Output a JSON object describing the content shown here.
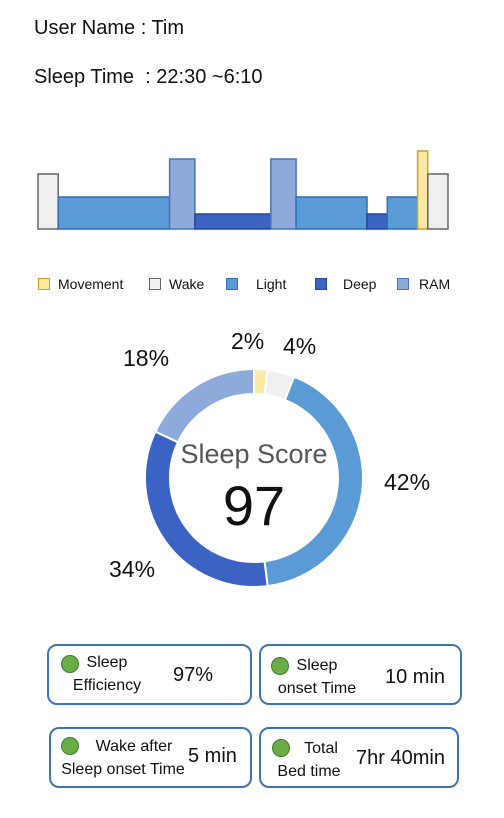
{
  "user": {
    "label": "User Name",
    "separator": " : ",
    "name": "Tim"
  },
  "sleep_time": {
    "label": "Sleep Time",
    "separator": "  : ",
    "range": "22:30 ~6:10"
  },
  "stage_colors": {
    "movement": "#fbe9a6",
    "movement_border": "#d4a020",
    "wake": "#f0f0f0",
    "wake_border": "#666666",
    "light": "#5b9bd5",
    "light_border": "#2e6fb0",
    "deep": "#3b63c4",
    "deep_border": "#23479c",
    "ram": "#8eaadb",
    "ram_border": "#4b72b8"
  },
  "hypnogram": {
    "segments": [
      {
        "stage": "wake",
        "duration": 2
      },
      {
        "stage": "light",
        "duration": 11
      },
      {
        "stage": "ram",
        "duration": 2.5
      },
      {
        "stage": "deep",
        "duration": 7.5
      },
      {
        "stage": "ram",
        "duration": 2.5
      },
      {
        "stage": "light",
        "duration": 7
      },
      {
        "stage": "deep",
        "duration": 2
      },
      {
        "stage": "light",
        "duration": 3
      },
      {
        "stage": "movement",
        "duration": 1
      },
      {
        "stage": "wake",
        "duration": 2
      }
    ]
  },
  "legend": [
    {
      "key": "movement",
      "label": "Movement"
    },
    {
      "key": "wake",
      "label": "Wake"
    },
    {
      "key": "light",
      "label": "Light"
    },
    {
      "key": "deep",
      "label": "Deep"
    },
    {
      "key": "ram",
      "label": "RAM"
    }
  ],
  "sleep_score": {
    "title": "Sleep Score",
    "value": "97",
    "breakdown": [
      {
        "stage": "movement",
        "percent": 2,
        "label": "2%"
      },
      {
        "stage": "wake",
        "percent": 4,
        "label": "4%"
      },
      {
        "stage": "light",
        "percent": 42,
        "label": "42%"
      },
      {
        "stage": "deep",
        "percent": 34,
        "label": "34%"
      },
      {
        "stage": "ram",
        "percent": 18,
        "label": "18%"
      }
    ]
  },
  "metrics": [
    {
      "label_lines": [
        "Sleep",
        "Efficiency"
      ],
      "value": "97%"
    },
    {
      "label_lines": [
        "Sleep",
        "onset Time"
      ],
      "value": "10 min"
    },
    {
      "label_lines": [
        "Wake after",
        "Sleep onset Time"
      ],
      "value": "5 min"
    },
    {
      "label_lines": [
        "Total",
        "Bed time"
      ],
      "value": "7hr 40min"
    }
  ]
}
